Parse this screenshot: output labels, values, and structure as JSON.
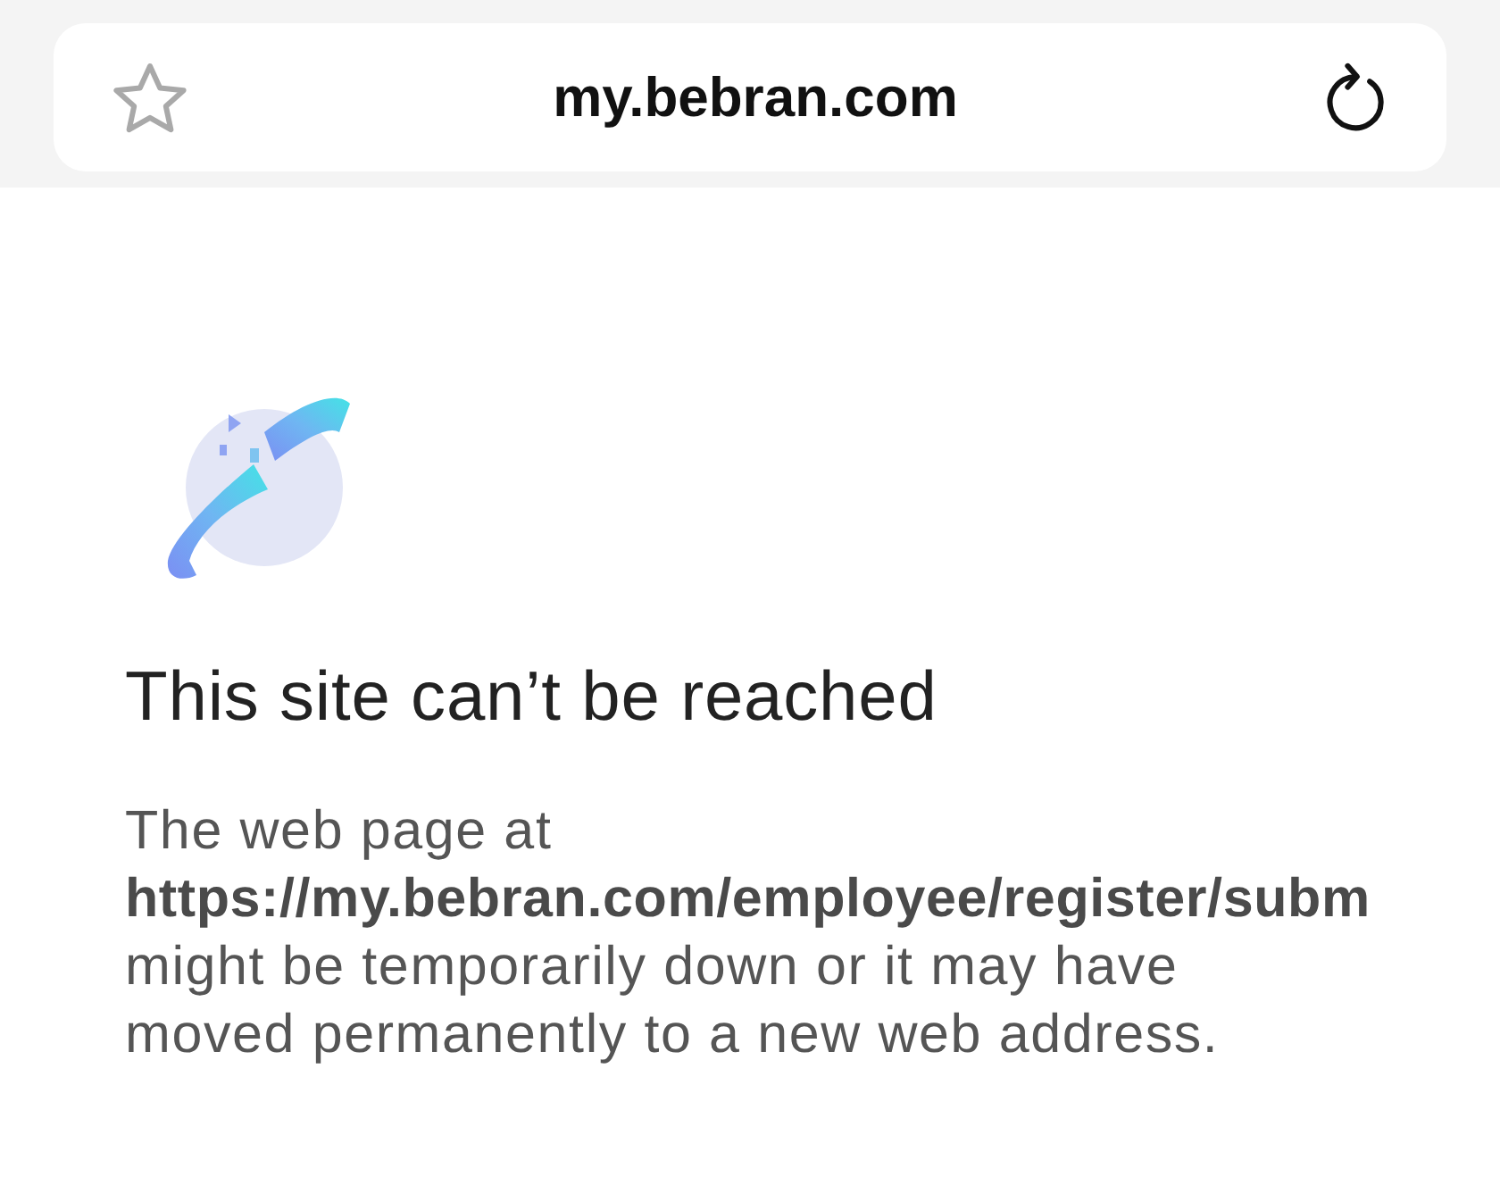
{
  "address_bar": {
    "bookmarked": false,
    "title": "my.bebran.com"
  },
  "error": {
    "heading": "This site can’t be reached",
    "message": "The web page at **https://my.bebran.com/employee/register/subm** might be temporarily down or it may have moved permanently to a new web address."
  }
}
